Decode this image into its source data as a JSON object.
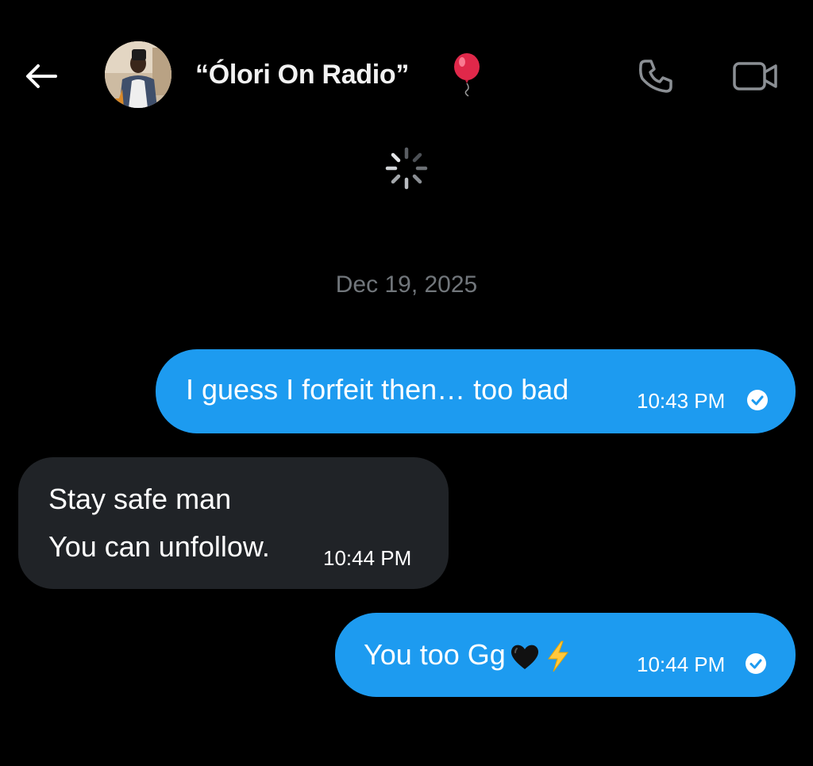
{
  "header": {
    "title": "“Ólori On Radio”",
    "icons": {
      "back": "back-arrow-icon",
      "avatar": "profile-avatar",
      "title_emoji": "balloon-icon",
      "call": "phone-icon",
      "video": "video-camera-icon"
    }
  },
  "loading": {
    "icon": "loading-spinner-icon"
  },
  "conversation": {
    "date_separator": "Dec 19, 2025",
    "messages": [
      {
        "direction": "sent",
        "text": "I guess I forfeit then… too bad",
        "time": "10:43 PM",
        "status_icon": "read-check-icon"
      },
      {
        "direction": "received",
        "lines": [
          "Stay safe man",
          "You can unfollow."
        ],
        "time": "10:44 PM"
      },
      {
        "direction": "sent",
        "text": "You too Gg",
        "emojis": [
          "black-heart-icon",
          "lightning-icon"
        ],
        "time": "10:44 PM",
        "status_icon": "read-check-icon"
      }
    ]
  },
  "colors": {
    "background": "#000000",
    "sent_bubble": "#1d9bf0",
    "received_bubble": "#202327",
    "muted_text": "#71767b",
    "header_icons": "#8b8f94"
  }
}
